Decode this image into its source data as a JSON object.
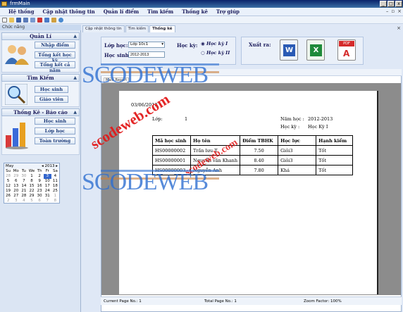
{
  "window": {
    "title": "frmMain",
    "buttons": [
      "_",
      "□",
      "x"
    ]
  },
  "menu": [
    "Hệ thống",
    "Cập nhật thông tin",
    "Quản lí điểm",
    "Tìm kiếm",
    "Thống kê",
    "Trợ giúp"
  ],
  "sidebar": {
    "header": "Chức năng",
    "groups": [
      {
        "title": "Quản Lí",
        "buttons": [
          "Nhập điểm",
          "Tổng kết học kỳ",
          "Tổng kết cả năm"
        ]
      },
      {
        "title": "Tìm Kiếm",
        "buttons": [
          "Học sinh",
          "Giáo viên"
        ]
      },
      {
        "title": "Thống Kê - Báo cáo",
        "buttons": [
          "Học sinh",
          "Lớp học",
          "Toàn trường"
        ]
      }
    ],
    "calendar": {
      "month": "May",
      "year": "2013",
      "weekdays": [
        "Su",
        "Mo",
        "Tu",
        "We",
        "Th",
        "Fr",
        "Sa"
      ],
      "weeks": [
        [
          "28",
          "29",
          "30",
          "1",
          "2",
          "3",
          "4"
        ],
        [
          "5",
          "6",
          "7",
          "8",
          "9",
          "10",
          "11"
        ],
        [
          "12",
          "13",
          "14",
          "15",
          "16",
          "17",
          "18"
        ],
        [
          "19",
          "20",
          "21",
          "22",
          "23",
          "24",
          "25"
        ],
        [
          "26",
          "27",
          "28",
          "29",
          "30",
          "31",
          "1"
        ],
        [
          "2",
          "3",
          "4",
          "5",
          "6",
          "7",
          "8"
        ]
      ],
      "selected": "3"
    }
  },
  "tabs": [
    "Cập nhật thông tin",
    "Tìm kiếm",
    "Thống kê"
  ],
  "active_tab": "Thống kê",
  "filter": {
    "class_label": "Lớp học:",
    "class_value": "Lớp 10c1",
    "student_label": "Học sinh:",
    "student_value": "2012-2013",
    "term_label": "Học kỳ:",
    "term_options": [
      "Học kỳ I",
      "Học kỳ II"
    ],
    "term_selected": "Học kỳ I"
  },
  "export": {
    "label": "Xuất ra:",
    "formats": [
      "Word",
      "Excel",
      "PDF"
    ]
  },
  "report": {
    "tab_label": "Main Report",
    "date": "03/06/2013",
    "class_label": "Lớp:",
    "class_value": "1",
    "year_label": "Năm học :",
    "year_value": "2012-2013",
    "term_label": "Học kỳ :",
    "term_value": "Học Kỳ I",
    "columns": [
      "Mã học sinh",
      "Họ tên",
      "Điểm TBHK",
      "Học lực",
      "Hạnh kiểm"
    ],
    "rows": [
      [
        "HS00000002",
        "Trần lưu T",
        "7.50",
        "Giỏi3",
        "Tốt"
      ],
      [
        "HS00000001",
        "Nguyễn văn Khanh",
        "8.40",
        "Giỏi3",
        "Tốt"
      ],
      [
        "HS00000003",
        "Nguyễn Anh",
        "7.80",
        "Khá",
        "Tốt"
      ]
    ]
  },
  "status": {
    "current_page": "Current Page No.: 1",
    "total_page": "Total Page No.: 1",
    "zoom": "Zoom Factor: 100%"
  },
  "watermark": {
    "brand1": "SCODEWEB",
    "diagonal": "scodeweb.com",
    "diagonal2": "scodeweb.com",
    "brand2": "SCODEWEB"
  }
}
